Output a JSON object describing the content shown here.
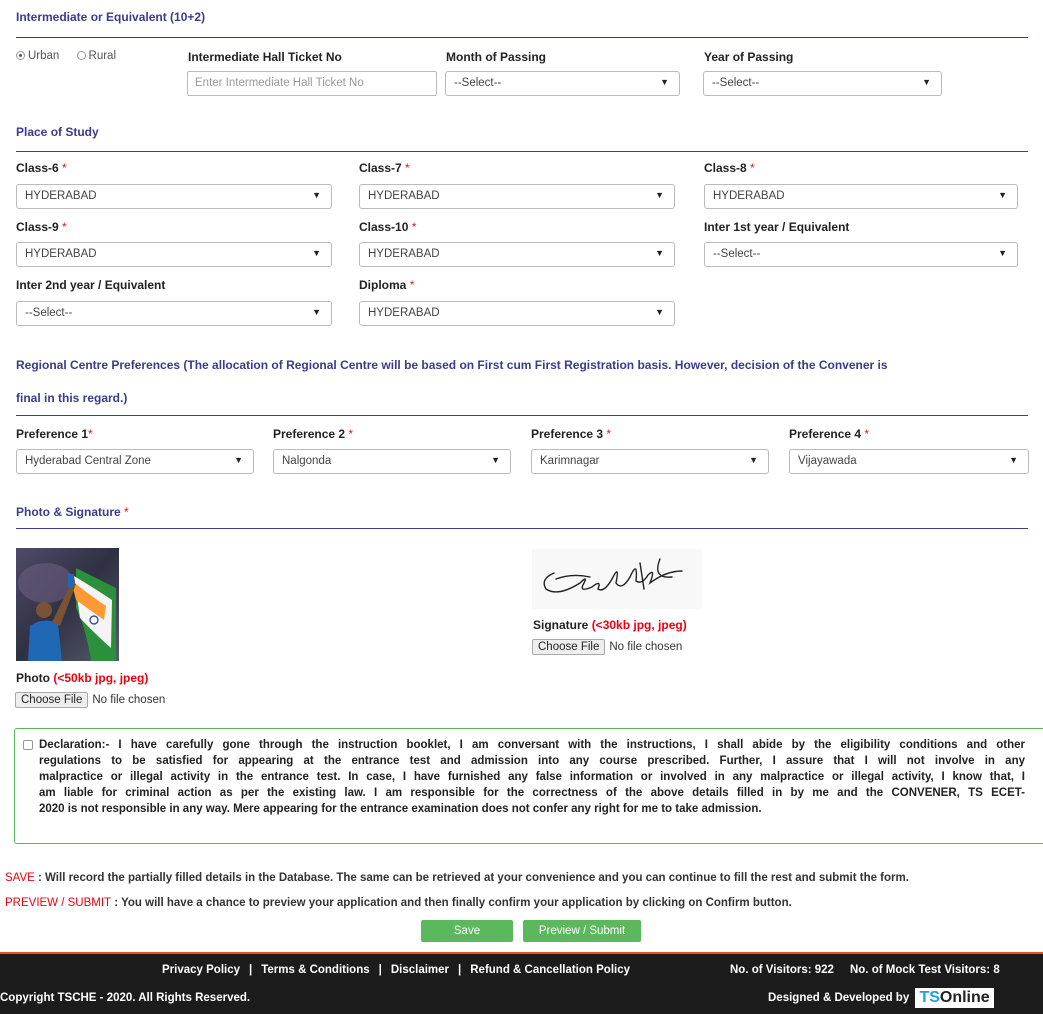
{
  "intermediate": {
    "title": "Intermediate or Equivalent (10+2)",
    "area_options": [
      "Urban",
      "Rural"
    ],
    "hall_ticket_label": "Intermediate Hall Ticket No",
    "hall_ticket_placeholder": "Enter Intermediate Hall Ticket No",
    "month_label": "Month of Passing",
    "month_value": "--Select--",
    "year_label": "Year of Passing",
    "year_value": "--Select--"
  },
  "place_of_study": {
    "title": "Place of Study",
    "fields": [
      {
        "label": "Class-6",
        "required": "*",
        "value": "HYDERABAD"
      },
      {
        "label": "Class-7",
        "required": "*",
        "value": "HYDERABAD"
      },
      {
        "label": "Class-8",
        "required": "*",
        "value": "HYDERABAD"
      },
      {
        "label": "Class-9",
        "required": "*",
        "value": "HYDERABAD"
      },
      {
        "label": "Class-10",
        "required": "*",
        "value": "HYDERABAD"
      },
      {
        "label": "Inter 1st year / Equivalent",
        "required": "",
        "value": "--Select--"
      },
      {
        "label": "Inter 2nd year / Equivalent",
        "required": "",
        "value": "--Select--"
      },
      {
        "label": "Diploma",
        "required": "*",
        "value": "HYDERABAD"
      }
    ]
  },
  "regional": {
    "title_line1": "Regional Centre Preferences (The allocation of Regional Centre will be based on First cum First Registration basis. However, decision of the Convener is",
    "title_line2": "final in this regard.)",
    "prefs": [
      {
        "label": "Preference 1",
        "required": "*",
        "value": "Hyderabad Central Zone"
      },
      {
        "label": "Preference 2",
        "required": "*",
        "value": "Nalgonda"
      },
      {
        "label": "Preference 3",
        "required": "*",
        "value": "Karimnagar"
      },
      {
        "label": "Preference 4",
        "required": "*",
        "value": "Vijayawada"
      }
    ]
  },
  "photo_signature": {
    "title": "Photo & Signature",
    "required": "*",
    "photo_label": "Photo",
    "photo_hint": "(<50kb jpg, jpeg)",
    "signature_label": "Signature",
    "signature_hint": "(<30kb jpg, jpeg)",
    "choose_file": "Choose File",
    "no_file": "No file chosen"
  },
  "declaration": {
    "line1": "Declaration:- I have carefully gone through the instruction booklet, I am conversant with the instructions, I shall abide by the eligibility conditions and other",
    "line2": "regulations to be satisfied for appearing at the entrance test and admission into any course prescribed. Further, I assure that I will not involve in any",
    "line3": "malpractice or illegal activity in the entrance test. In case, I have furnished any false information or involved in any malpractice or illegal activity, I know that, I",
    "line4": "am liable for criminal action as per the existing law. I am responsible for the correctness of the above details filled in by me and the CONVENER, TS ECET-",
    "line5": "2020 is not responsible in any way. Mere appearing for the entrance examination does not confer any right for me to take admission."
  },
  "notes": {
    "save_key": "SAVE",
    "save_text": " : Will record the partially filled details in the Database. The same can be retrieved at your convenience and you can continue to fill the rest and submit the form.",
    "preview_key": "PREVIEW / SUBMIT",
    "preview_text": " : You will have a chance to preview your application and then finally confirm your application by clicking on Confirm button."
  },
  "buttons": {
    "save": "Save",
    "preview": "Preview / Submit"
  },
  "footer": {
    "links": [
      "Privacy Policy",
      "Terms & Conditions",
      "Disclaimer",
      "Refund & Cancellation Policy"
    ],
    "separator": "|",
    "visitors": "No. of Visitors: 922",
    "mock_visitors": "No. of Mock Test Visitors: 8",
    "copyright": "Copyright TSCHE - 2020. All Rights Reserved.",
    "designed_by": "Designed & Developed by",
    "brand_ts": "TS",
    "brand_online": "Online"
  },
  "colors": {
    "section_title": "#3b3b8f",
    "required": "#e11111",
    "button_green": "#5cb85c",
    "footer_bg": "#1c1c1c",
    "brand_blue": "#1ea0e0"
  }
}
